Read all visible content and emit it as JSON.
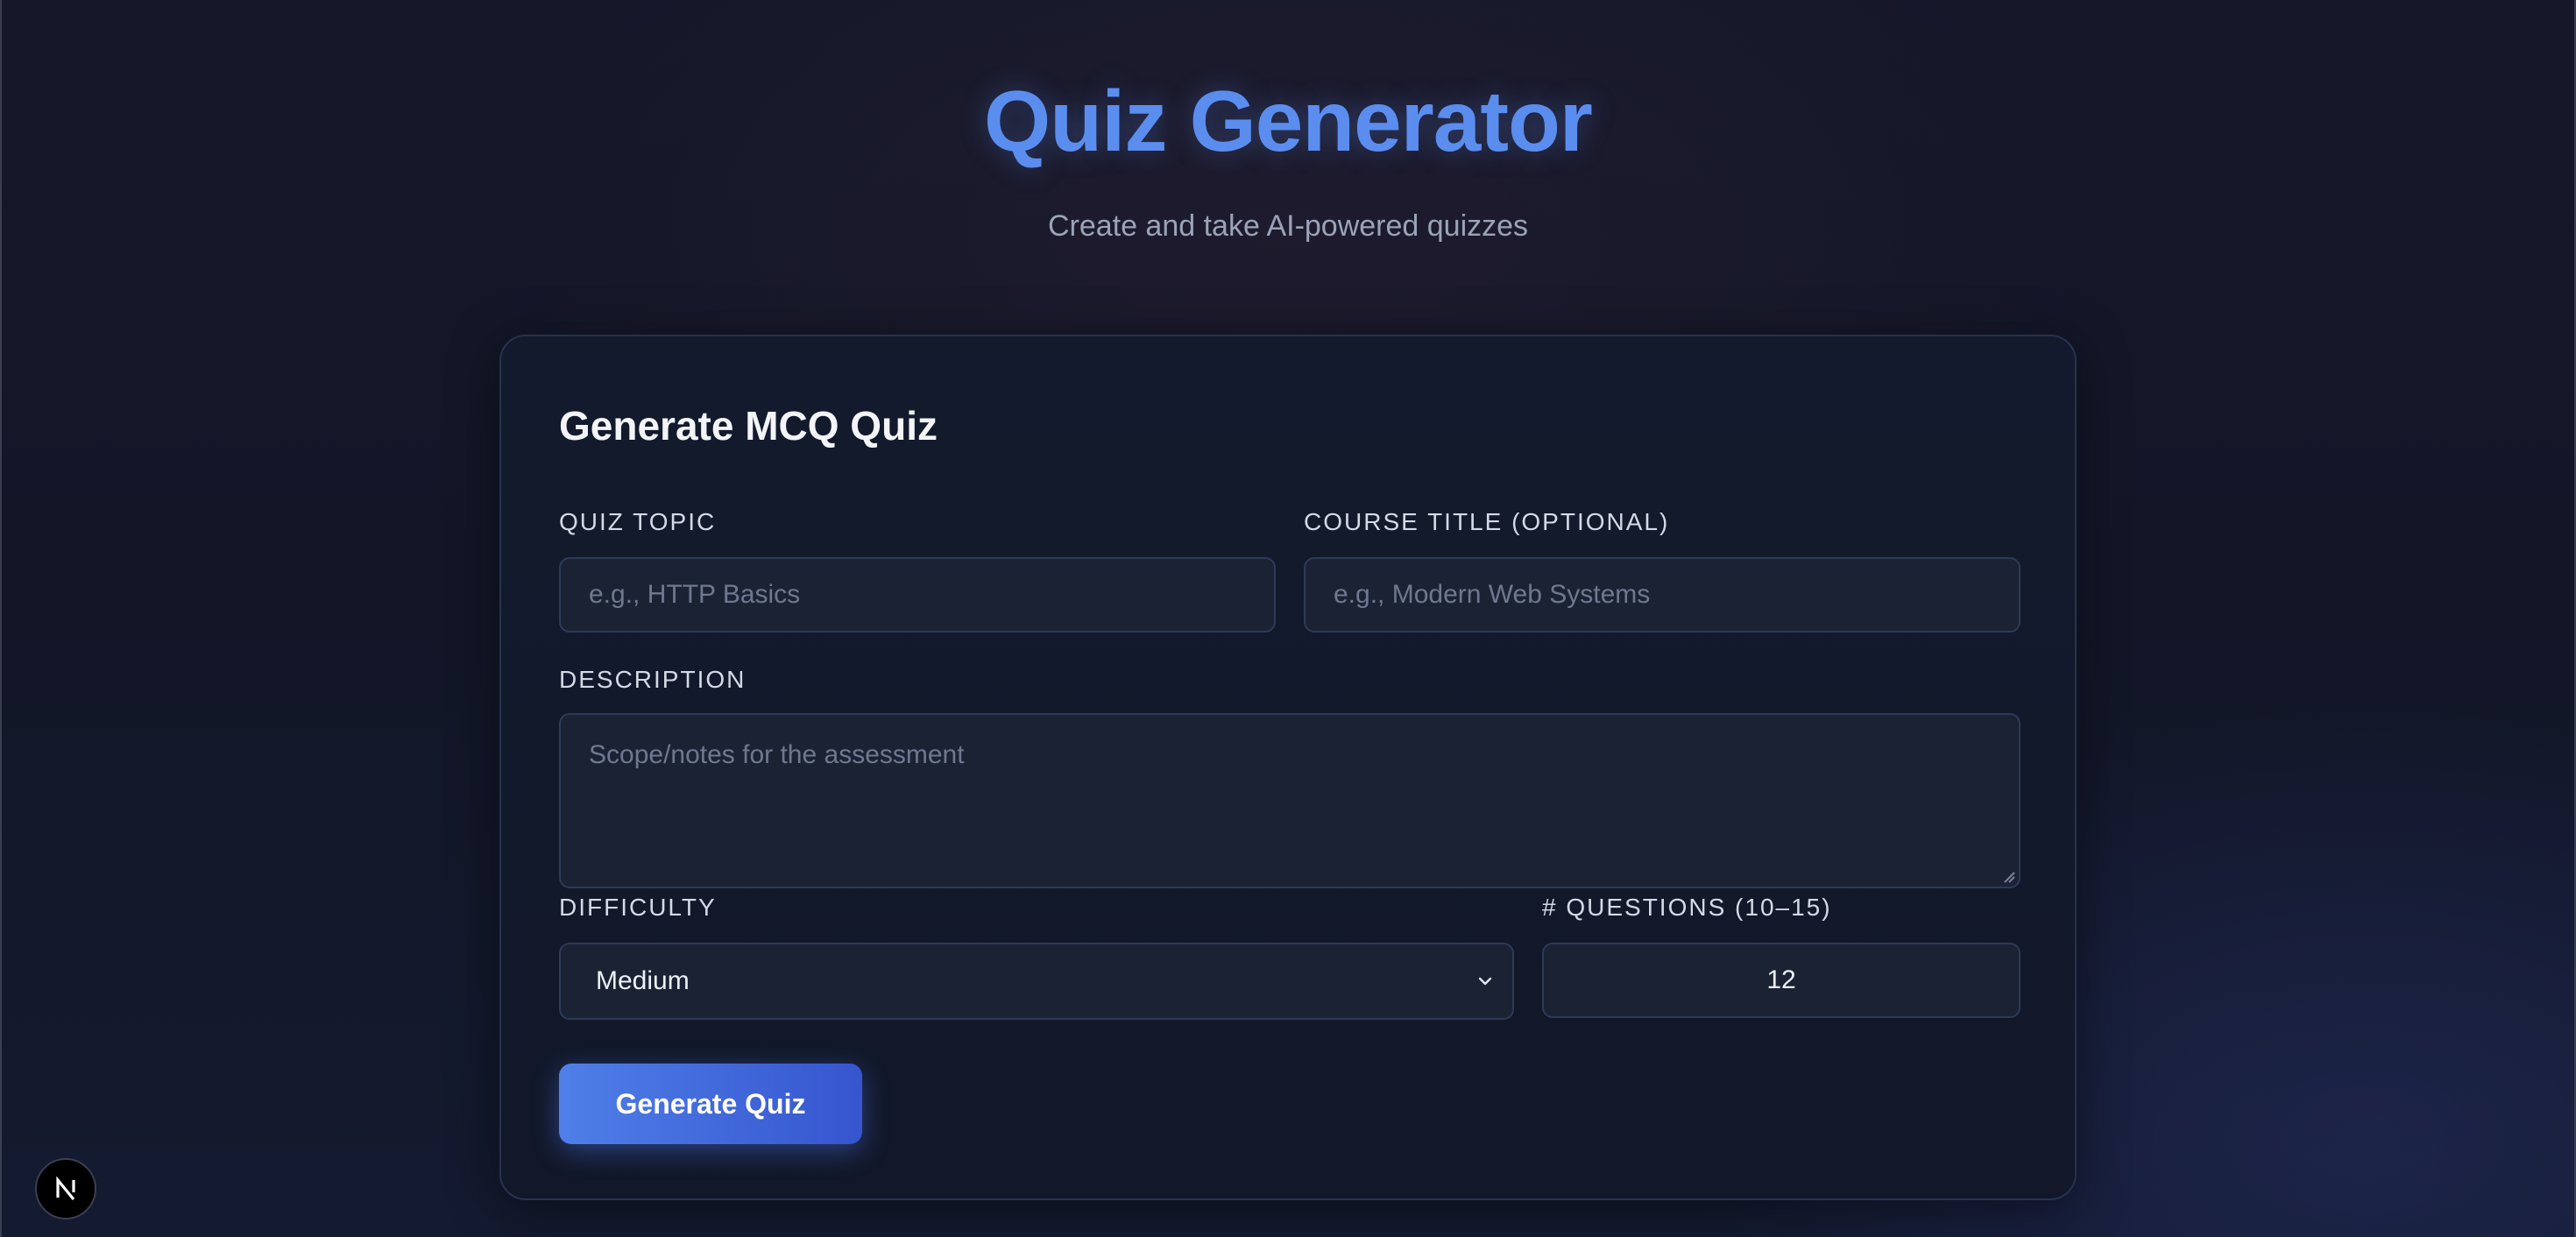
{
  "header": {
    "title": "Quiz Generator",
    "subtitle": "Create and take AI-powered quizzes"
  },
  "form": {
    "title": "Generate MCQ Quiz",
    "topic": {
      "label": "QUIZ TOPIC",
      "placeholder": "e.g., HTTP Basics",
      "value": ""
    },
    "course": {
      "label": "COURSE TITLE (OPTIONAL)",
      "placeholder": "e.g., Modern Web Systems",
      "value": ""
    },
    "description": {
      "label": "DESCRIPTION",
      "placeholder": "Scope/notes for the assessment",
      "value": ""
    },
    "difficulty": {
      "label": "DIFFICULTY",
      "selected": "Medium"
    },
    "questions": {
      "label": "# QUESTIONS (10–15)",
      "value": "12"
    },
    "submit_label": "Generate Quiz"
  },
  "devtools": {
    "badge_letter": "N",
    "icon": "nextjs-icon"
  },
  "colors": {
    "accent": "#5b8def",
    "button_start": "#4f7fe8",
    "button_end": "#3655cf",
    "background": "#131728"
  }
}
